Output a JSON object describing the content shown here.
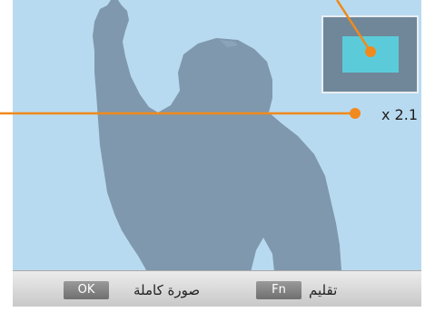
{
  "screen": {
    "zoom_label": "x 2.1"
  },
  "bottom_bar": {
    "full_image_button": "OK",
    "full_image_label": "صورة كاملة",
    "flip_button": "Fn",
    "flip_label": "تقليم"
  },
  "colors": {
    "screen_bg": "#b8daf0",
    "silhouette": "#7f98ad",
    "preview_bg": "#6f8799",
    "preview_area": "#5ccbd9",
    "callout": "#f08a1c"
  }
}
